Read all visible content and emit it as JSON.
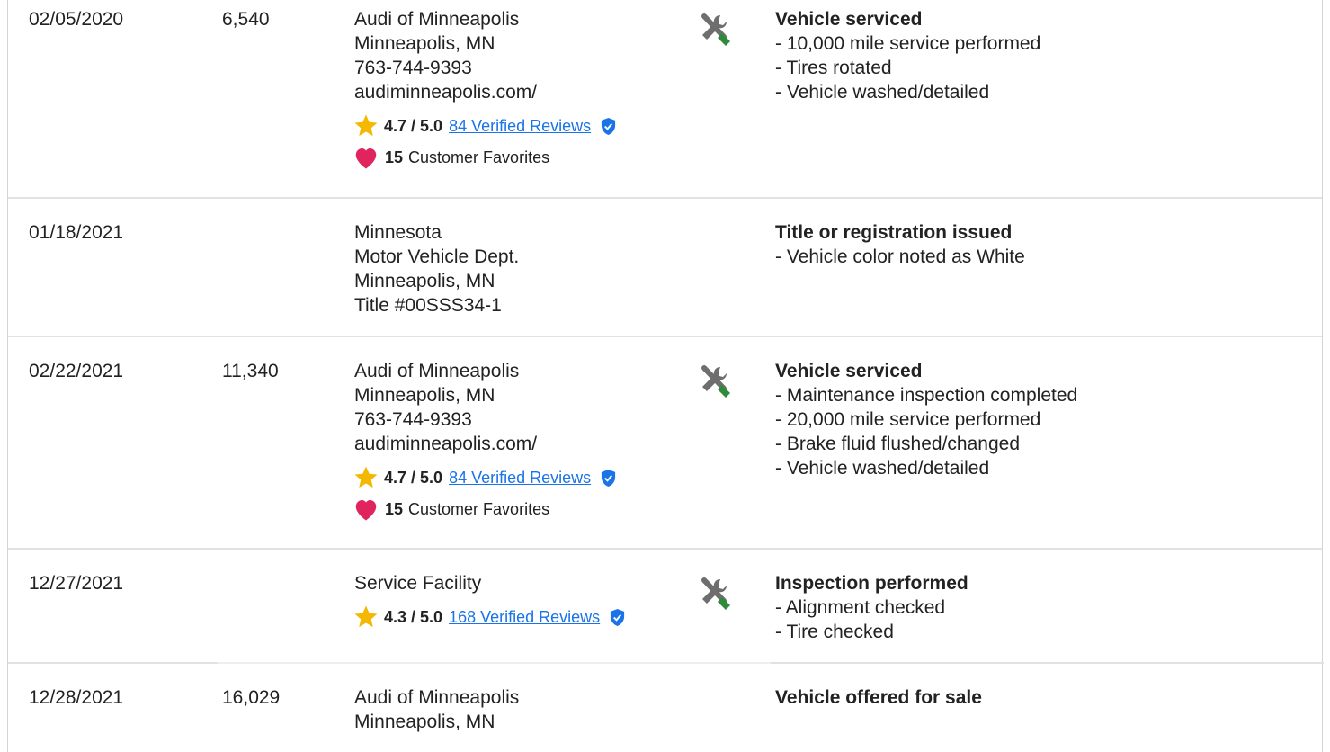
{
  "records": [
    {
      "date": "02/05/2020",
      "mileage": "6,540",
      "source_lines": [
        "Audi of Minneapolis",
        "Minneapolis, MN",
        "763-744-9393",
        "audiminneapolis.com/"
      ],
      "rating": {
        "score": "4.7 / 5.0",
        "reviews_label": "84 Verified Reviews"
      },
      "favorites": {
        "count": "15",
        "label": "Customer Favorites"
      },
      "icon": "service-tools-icon",
      "detail_title": "Vehicle serviced",
      "details": [
        "- 10,000 mile service performed",
        "- Tires rotated",
        "- Vehicle washed/detailed"
      ]
    },
    {
      "date": "01/18/2021",
      "mileage": "",
      "source_lines": [
        "Minnesota",
        "Motor Vehicle Dept.",
        "Minneapolis, MN",
        "Title #00SSS34-1"
      ],
      "detail_title": "Title or registration issued",
      "details": [
        "- Vehicle color noted as White"
      ]
    },
    {
      "date": "02/22/2021",
      "mileage": "11,340",
      "source_lines": [
        "Audi of Minneapolis",
        "Minneapolis, MN",
        "763-744-9393",
        "audiminneapolis.com/"
      ],
      "rating": {
        "score": "4.7 / 5.0",
        "reviews_label": "84 Verified Reviews"
      },
      "favorites": {
        "count": "15",
        "label": "Customer Favorites"
      },
      "icon": "service-tools-icon",
      "detail_title": "Vehicle serviced",
      "details": [
        "- Maintenance inspection completed",
        "- 20,000 mile service performed",
        "- Brake fluid flushed/changed",
        "- Vehicle washed/detailed"
      ]
    },
    {
      "date": "12/27/2021",
      "mileage": "",
      "source_lines": [
        "Service Facility"
      ],
      "rating": {
        "score": "4.3 / 5.0",
        "reviews_label": "168 Verified Reviews"
      },
      "icon": "service-tools-icon",
      "detail_title": "Inspection performed",
      "details": [
        "- Alignment checked",
        "- Tire checked"
      ]
    },
    {
      "date": "12/28/2021",
      "mileage": "16,029",
      "source_lines": [
        "Audi of Minneapolis",
        "Minneapolis, MN"
      ],
      "detail_title": "Vehicle offered for sale",
      "details": []
    }
  ],
  "colors": {
    "link": "#1a73e8",
    "star": "#f5b800",
    "heart": "#e0245e",
    "shield": "#1a73e8",
    "tool_gray": "#6e6e6e",
    "tool_green": "#2e8b3a"
  }
}
